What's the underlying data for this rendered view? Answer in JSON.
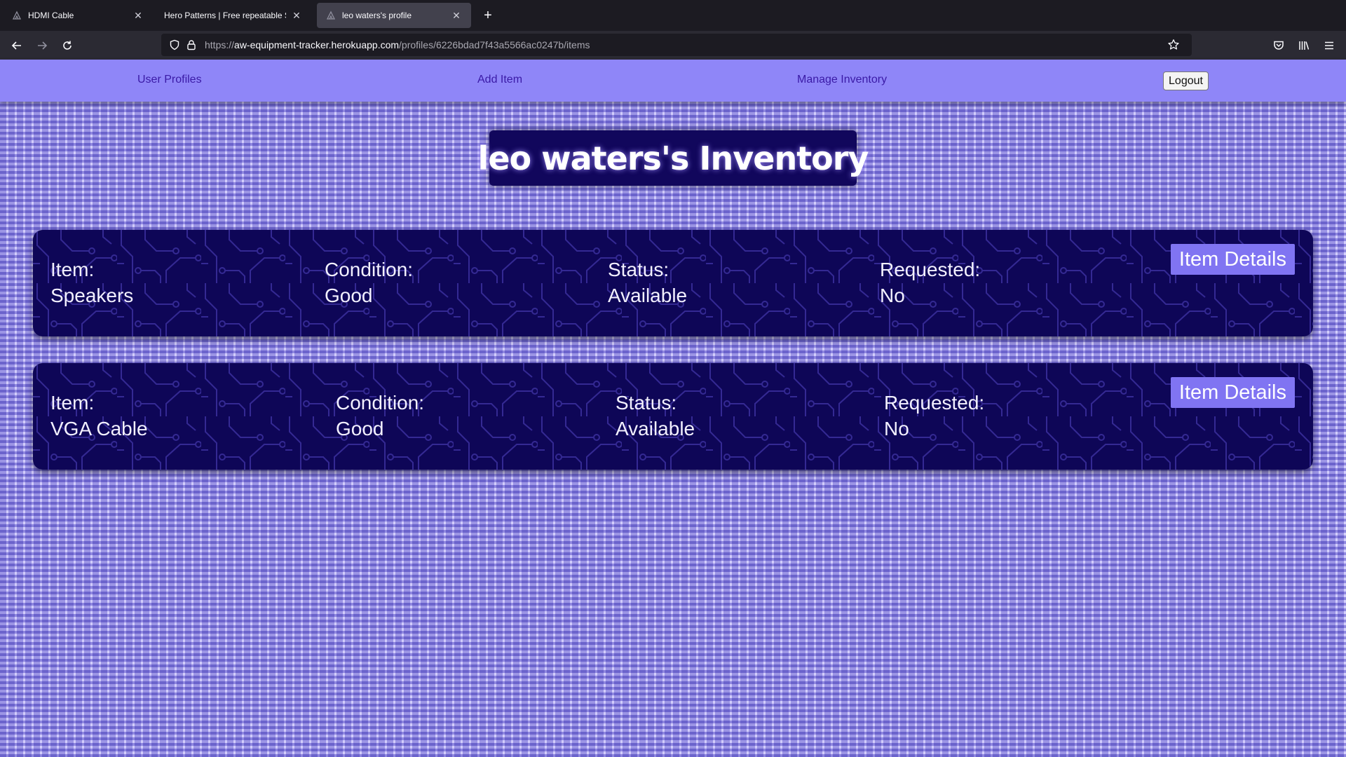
{
  "browser": {
    "tabs": [
      {
        "title": "HDMI Cable",
        "active": false
      },
      {
        "title": "Hero Patterns | Free repeatable SVG",
        "active": false
      },
      {
        "title": "leo waters's profile",
        "active": true
      }
    ],
    "url": {
      "scheme": "https://",
      "host": "aw-equipment-tracker.herokuapp.com",
      "path": "/profiles/6226bdad7f43a5566ac0247b/items"
    }
  },
  "nav": {
    "links": [
      "User Profiles",
      "Add Item",
      "Manage Inventory"
    ],
    "logout_label": "Logout",
    "background_color": "#8f86f8",
    "link_color": "#3a1aa6"
  },
  "page": {
    "title": "leo waters's Inventory",
    "title_bg": "#11075c"
  },
  "items": [
    {
      "item_label": "Item:",
      "item": "Speakers",
      "condition_label": "Condition:",
      "condition": "Good",
      "status_label": "Status:",
      "status": "Available",
      "requested_label": "Requested:",
      "requested": "No",
      "button": "Item Details"
    },
    {
      "item_label": "Item:",
      "item": "VGA Cable",
      "condition_label": "Condition:",
      "condition": "Good",
      "status_label": "Status:",
      "status": "Available",
      "requested_label": "Requested:",
      "requested": "No",
      "button": "Item Details"
    }
  ],
  "colors": {
    "card_bg": "#0e0657",
    "button_bg": "#8074f2",
    "page_pattern": "#d2cdfb"
  }
}
